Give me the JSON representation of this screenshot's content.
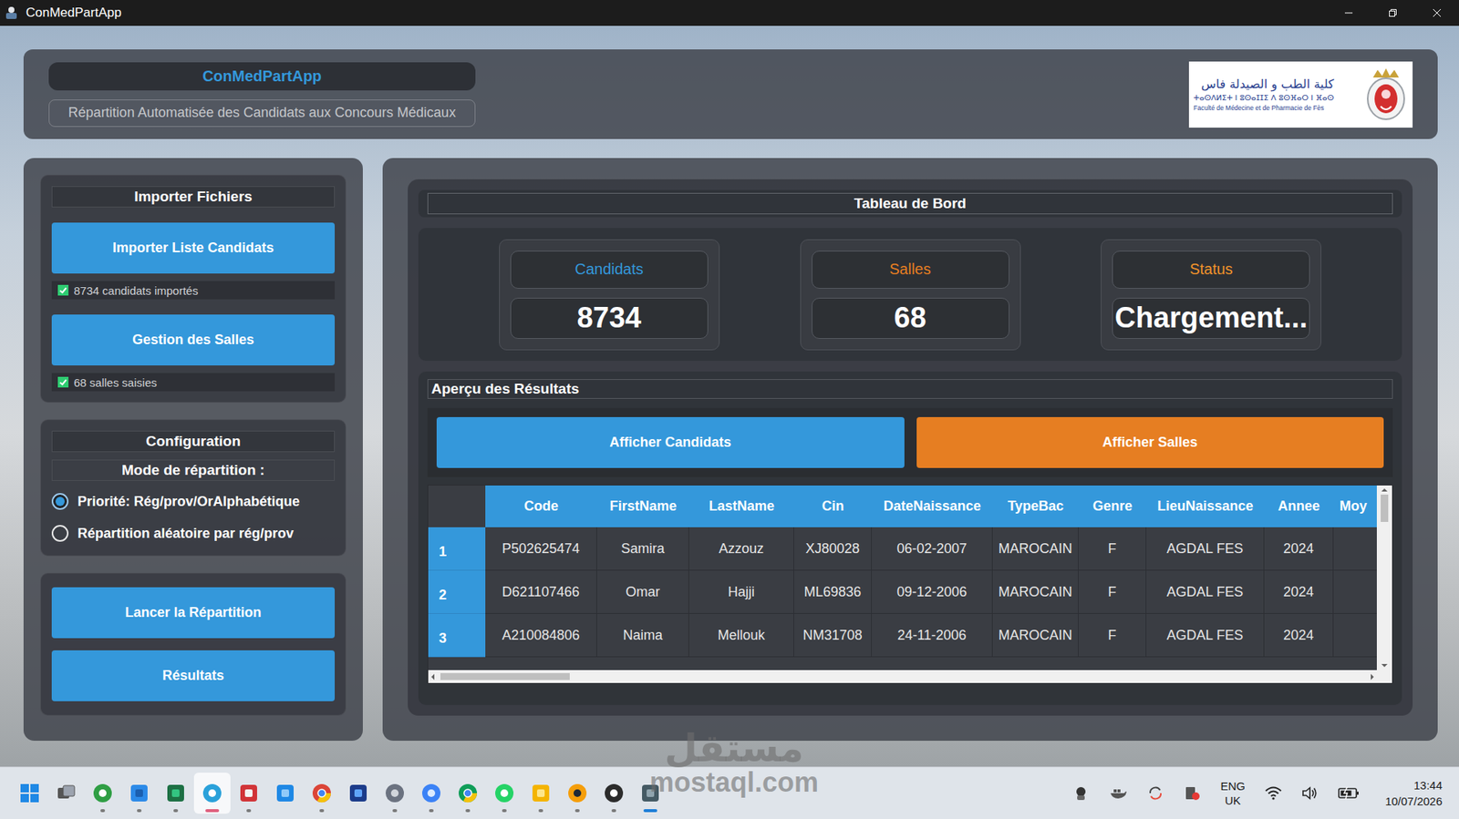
{
  "window": {
    "title": "ConMedPartApp"
  },
  "header": {
    "title": "ConMedPartApp",
    "subtitle": "Répartition Automatisée des Candidats aux Concours Médicaux",
    "logo": {
      "arabic": "كلية الطب و الصيدلة فاس",
      "tifinagh": "ⵜⴰⵙⴷⵍⵉⵜ ⵏ ⵓⵙⴰⵊⵊⵉ ⴷ ⵓⵙⴼⴰⵔ ⵏ ⴼⴰⵙ",
      "french": "Faculté de Médecine et de Pharmacie de Fès"
    }
  },
  "import": {
    "title": "Importer Fichiers",
    "items": [
      {
        "button": "Importer Liste Candidats",
        "status": "8734 candidats importés",
        "checked": true
      },
      {
        "button": "Gestion des Salles",
        "status": "68 salles saisies",
        "checked": true
      }
    ]
  },
  "config": {
    "title": "Configuration",
    "mode_label": "Mode de répartition :",
    "options": [
      {
        "label": "Priorité: Rég/prov/OrAlphabétique",
        "selected": true
      },
      {
        "label": "Répartition aléatoire par rég/prov",
        "selected": false
      }
    ]
  },
  "actions": [
    "Lancer la Répartition",
    "Résultats"
  ],
  "dashboard": {
    "title": "Tableau de Bord",
    "stats": [
      {
        "label": "Candidats",
        "value": "8734",
        "color": "#3498db"
      },
      {
        "label": "Salles",
        "value": "68",
        "color": "#e67e22"
      },
      {
        "label": "Status",
        "value": "Chargement...",
        "color": "#f0932b"
      }
    ]
  },
  "preview": {
    "title": "Aperçu des Résultats",
    "buttons": [
      {
        "label": "Afficher Candidats",
        "color": "#3498db"
      },
      {
        "label": "Afficher Salles",
        "color": "#e67e22"
      }
    ]
  },
  "table": {
    "columns": [
      "Code",
      "FirstName",
      "LastName",
      "Cin",
      "DateNaissance",
      "TypeBac",
      "Genre",
      "LieuNaissance",
      "Annee",
      "Moy"
    ],
    "rows": [
      {
        "index": "1",
        "cells": [
          "P502625474",
          "Samira",
          "Azzouz",
          "XJ80028",
          "06-02-2007",
          "MAROCAIN",
          "F",
          "AGDAL FES",
          "2024"
        ]
      },
      {
        "index": "2",
        "cells": [
          "D621107466",
          "Omar",
          "Hajji",
          "ML69836",
          "09-12-2006",
          "MAROCAIN",
          "F",
          "AGDAL FES",
          "2024"
        ]
      },
      {
        "index": "3",
        "cells": [
          "A210084806",
          "Naima",
          "Mellouk",
          "NM31708",
          "24-11-2006",
          "MAROCAIN",
          "F",
          "AGDAL FES",
          "2024"
        ]
      }
    ]
  },
  "taskbar": {
    "apps": [
      {
        "running": true,
        "selected": false,
        "attention": false
      },
      {
        "running": true,
        "selected": false,
        "attention": false
      },
      {
        "running": true,
        "selected": false,
        "attention": false
      },
      {
        "running": true,
        "selected": false,
        "attention": true
      },
      {
        "running": true,
        "selected": false,
        "attention": false
      },
      {
        "running": false,
        "selected": false,
        "attention": false
      },
      {
        "running": true,
        "selected": false,
        "attention": false
      },
      {
        "running": false,
        "selected": false,
        "attention": false
      },
      {
        "running": true,
        "selected": false,
        "attention": false
      },
      {
        "running": true,
        "selected": false,
        "attention": false
      },
      {
        "running": true,
        "selected": false,
        "attention": false
      },
      {
        "running": true,
        "selected": false,
        "attention": false
      },
      {
        "running": true,
        "selected": false,
        "attention": false
      },
      {
        "running": true,
        "selected": false,
        "attention": false
      },
      {
        "running": true,
        "selected": false,
        "attention": false
      },
      {
        "running": true,
        "selected": true,
        "attention": false
      }
    ],
    "language": [
      "ENG",
      "UK"
    ],
    "time": "13:44",
    "date": "10/07/2026"
  },
  "watermark": {
    "arabic": "مستقل",
    "latin": "mostaql.com"
  }
}
